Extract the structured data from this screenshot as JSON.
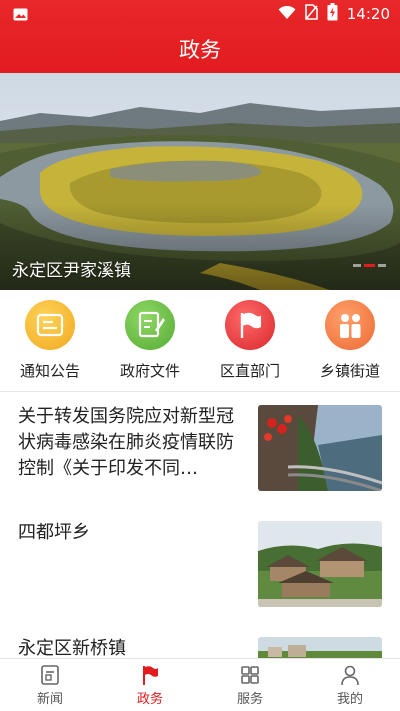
{
  "status_bar": {
    "time": "14:20"
  },
  "header": {
    "title": "政务"
  },
  "banner": {
    "caption": "永定区尹家溪镇",
    "slide_count": 3,
    "active_slide": 2
  },
  "quick_nav": [
    {
      "label": "通知公告",
      "icon": "notice-icon",
      "color": "#f3b42a"
    },
    {
      "label": "政府文件",
      "icon": "document-edit-icon",
      "color": "#6fc048"
    },
    {
      "label": "区直部门",
      "icon": "flag-icon",
      "color": "#e8383d"
    },
    {
      "label": "乡镇街道",
      "icon": "people-icon",
      "color": "#f4804a"
    }
  ],
  "news": [
    {
      "title": "关于转发国务院应对新型冠状病毒感染在肺炎疫情联防控制《关于印发不同…",
      "thumb": "cliff-walkway-photo"
    },
    {
      "title": "四都坪乡",
      "thumb": "village-houses-photo"
    },
    {
      "title": "永定区新桥镇",
      "thumb": "town-landscape-photo"
    }
  ],
  "tabbar": [
    {
      "label": "新闻",
      "icon": "news-icon",
      "active": false
    },
    {
      "label": "政务",
      "icon": "flag-icon",
      "active": true
    },
    {
      "label": "服务",
      "icon": "grid-icon",
      "active": false
    },
    {
      "label": "我的",
      "icon": "user-icon",
      "active": false
    }
  ],
  "colors": {
    "brand_red": "#e21b1e",
    "text": "#222222",
    "tab_inactive": "#555555"
  }
}
